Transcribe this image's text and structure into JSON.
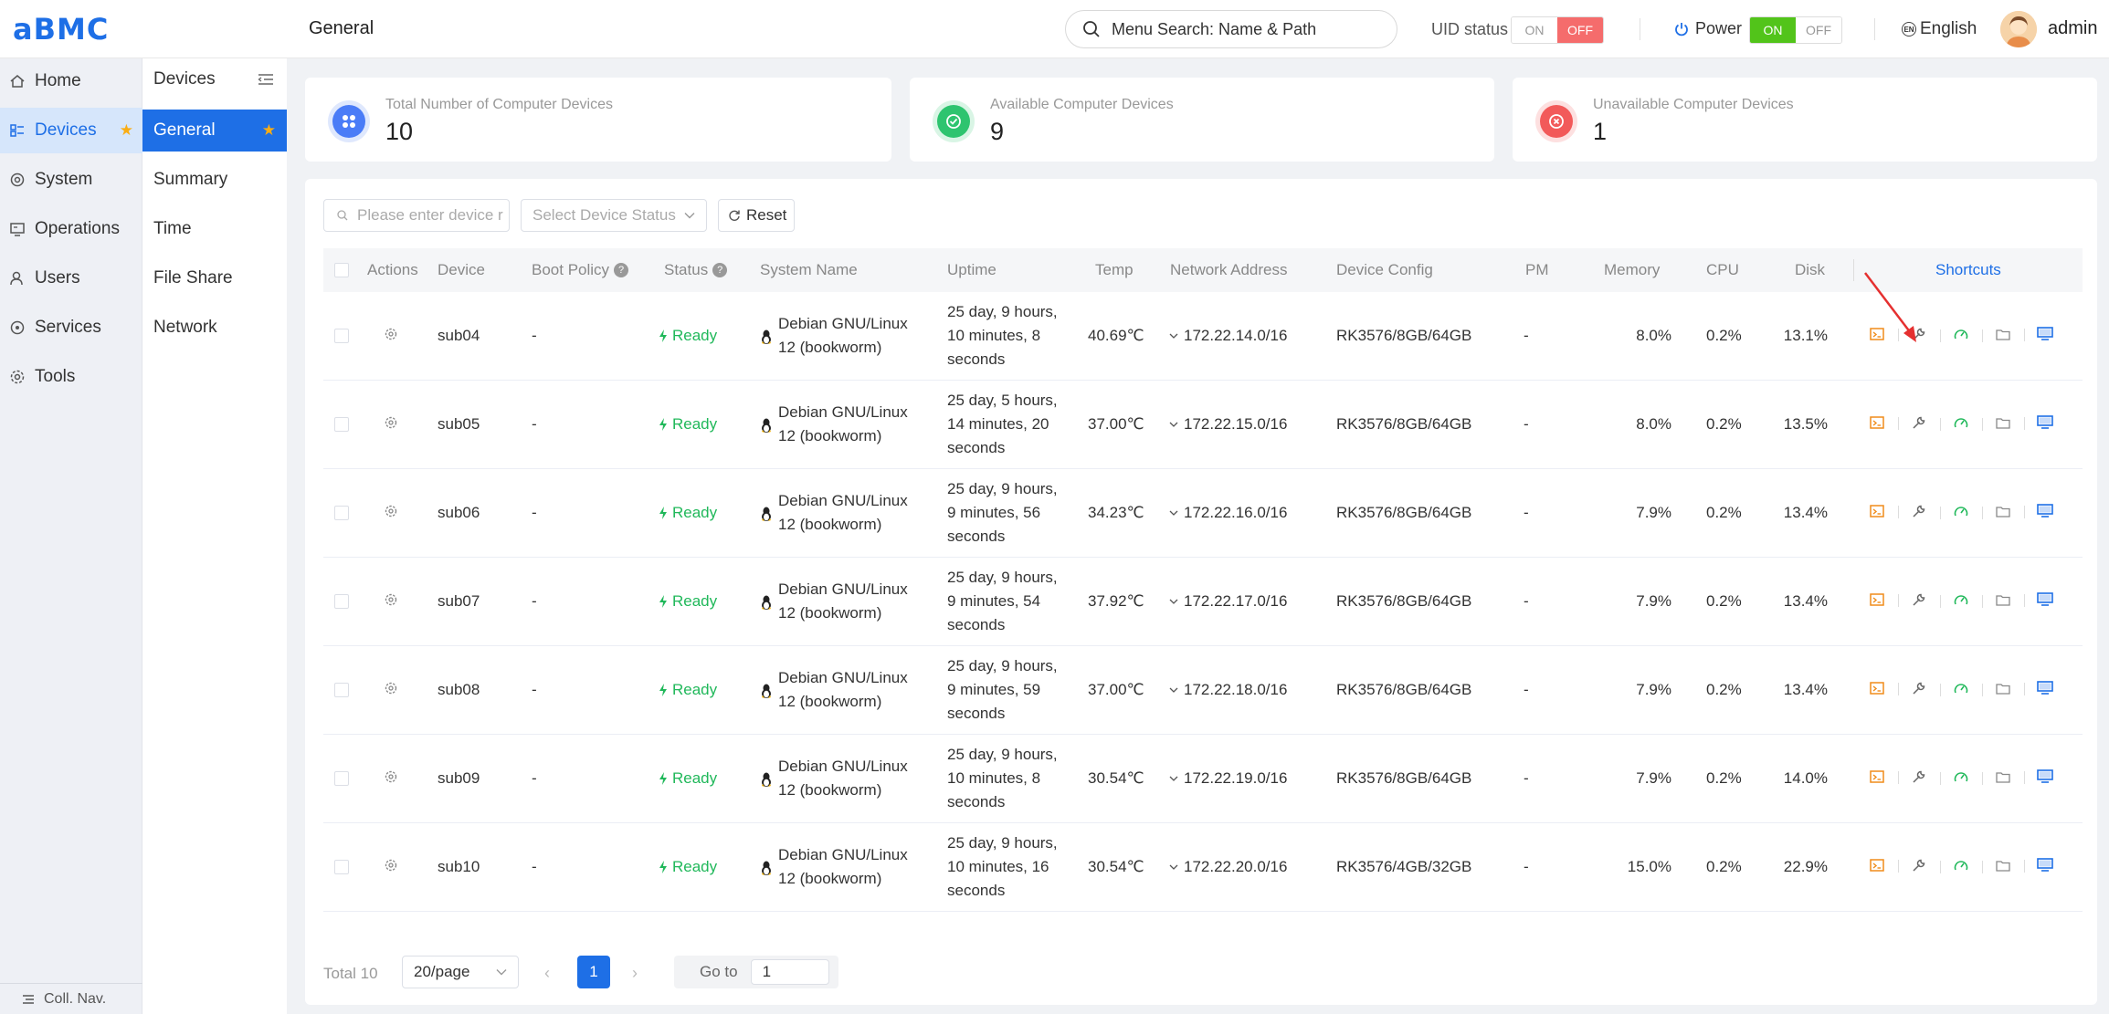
{
  "app": {
    "logo": "aBMC",
    "page_title": "General"
  },
  "search": {
    "label": "Menu Search: Name & Path"
  },
  "uid": {
    "label": "UID status",
    "on": "ON",
    "off": "OFF"
  },
  "power": {
    "label": "Power",
    "on": "ON",
    "off": "OFF"
  },
  "lang": {
    "badge": "EN",
    "label": "English"
  },
  "user": {
    "name": "admin"
  },
  "nav": {
    "items": [
      {
        "label": "Home",
        "icon": "home-icon"
      },
      {
        "label": "Devices",
        "icon": "devices-icon"
      },
      {
        "label": "System",
        "icon": "system-icon"
      },
      {
        "label": "Operations",
        "icon": "operations-icon"
      },
      {
        "label": "Users",
        "icon": "users-icon"
      },
      {
        "label": "Services",
        "icon": "services-icon"
      },
      {
        "label": "Tools",
        "icon": "tools-icon"
      }
    ],
    "collapse": "Coll. Nav."
  },
  "subnav": {
    "title": "Devices",
    "items": [
      "General",
      "Summary",
      "Time",
      "File Share",
      "Network"
    ]
  },
  "stats": [
    {
      "label": "Total Number of Computer Devices",
      "value": "10",
      "color": "#4a7cf7"
    },
    {
      "label": "Available Computer Devices",
      "value": "9",
      "color": "#2ec46f"
    },
    {
      "label": "Unavailable Computer Devices",
      "value": "1",
      "color": "#f25a5a"
    }
  ],
  "filters": {
    "device_placeholder": "Please enter device r",
    "status_placeholder": "Select Device Status",
    "reset": "Reset"
  },
  "table": {
    "headers": {
      "actions": "Actions",
      "device": "Device",
      "boot_policy": "Boot Policy",
      "status": "Status",
      "system_name": "System Name",
      "uptime": "Uptime",
      "temp": "Temp",
      "network": "Network Address",
      "config": "Device Config",
      "pm": "PM",
      "memory": "Memory",
      "cpu": "CPU",
      "disk": "Disk",
      "shortcuts": "Shortcuts"
    },
    "rows": [
      {
        "device": "sub04",
        "boot": "-",
        "status": "Ready",
        "sys1": "Debian GNU/Linux",
        "sys2": "12 (bookworm)",
        "up1": "25 day, 9 hours,",
        "up2": "10 minutes, 8",
        "up3": "seconds",
        "temp": "40.69℃",
        "net": "172.22.14.0/16",
        "config": "RK3576/8GB/64GB",
        "pm": "-",
        "mem": "8.0%",
        "cpu": "0.2%",
        "disk": "13.1%"
      },
      {
        "device": "sub05",
        "boot": "-",
        "status": "Ready",
        "sys1": "Debian GNU/Linux",
        "sys2": "12 (bookworm)",
        "up1": "25 day, 5 hours,",
        "up2": "14 minutes, 20",
        "up3": "seconds",
        "temp": "37.00℃",
        "net": "172.22.15.0/16",
        "config": "RK3576/8GB/64GB",
        "pm": "-",
        "mem": "8.0%",
        "cpu": "0.2%",
        "disk": "13.5%"
      },
      {
        "device": "sub06",
        "boot": "-",
        "status": "Ready",
        "sys1": "Debian GNU/Linux",
        "sys2": "12 (bookworm)",
        "up1": "25 day, 9 hours,",
        "up2": "9 minutes, 56",
        "up3": "seconds",
        "temp": "34.23℃",
        "net": "172.22.16.0/16",
        "config": "RK3576/8GB/64GB",
        "pm": "-",
        "mem": "7.9%",
        "cpu": "0.2%",
        "disk": "13.4%"
      },
      {
        "device": "sub07",
        "boot": "-",
        "status": "Ready",
        "sys1": "Debian GNU/Linux",
        "sys2": "12 (bookworm)",
        "up1": "25 day, 9 hours,",
        "up2": "9 minutes, 54",
        "up3": "seconds",
        "temp": "37.92℃",
        "net": "172.22.17.0/16",
        "config": "RK3576/8GB/64GB",
        "pm": "-",
        "mem": "7.9%",
        "cpu": "0.2%",
        "disk": "13.4%"
      },
      {
        "device": "sub08",
        "boot": "-",
        "status": "Ready",
        "sys1": "Debian GNU/Linux",
        "sys2": "12 (bookworm)",
        "up1": "25 day, 9 hours,",
        "up2": "9 minutes, 59",
        "up3": "seconds",
        "temp": "37.00℃",
        "net": "172.22.18.0/16",
        "config": "RK3576/8GB/64GB",
        "pm": "-",
        "mem": "7.9%",
        "cpu": "0.2%",
        "disk": "13.4%"
      },
      {
        "device": "sub09",
        "boot": "-",
        "status": "Ready",
        "sys1": "Debian GNU/Linux",
        "sys2": "12 (bookworm)",
        "up1": "25 day, 9 hours,",
        "up2": "10 minutes, 8",
        "up3": "seconds",
        "temp": "30.54℃",
        "net": "172.22.19.0/16",
        "config": "RK3576/8GB/64GB",
        "pm": "-",
        "mem": "7.9%",
        "cpu": "0.2%",
        "disk": "14.0%"
      },
      {
        "device": "sub10",
        "boot": "-",
        "status": "Ready",
        "sys1": "Debian GNU/Linux",
        "sys2": "12 (bookworm)",
        "up1": "25 day, 9 hours,",
        "up2": "10 minutes, 16",
        "up3": "seconds",
        "temp": "30.54℃",
        "net": "172.22.20.0/16",
        "config": "RK3576/4GB/32GB",
        "pm": "-",
        "mem": "15.0%",
        "cpu": "0.2%",
        "disk": "22.9%"
      }
    ]
  },
  "pagination": {
    "total": "Total 10",
    "page_size": "20/page",
    "current": "1",
    "goto_label": "Go to",
    "goto_value": "1"
  },
  "colors": {
    "accent": "#1e6fe6",
    "ready": "#20b85a",
    "terminal": "#f08c1a",
    "off": "#f56c6c",
    "on": "#52c41a"
  }
}
